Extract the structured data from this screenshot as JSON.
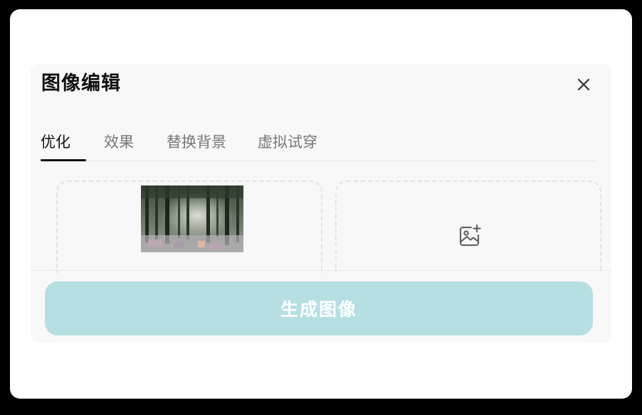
{
  "dialog": {
    "title": "图像编辑",
    "close_icon": "close-icon"
  },
  "tabs": [
    {
      "label": "优化",
      "active": true
    },
    {
      "label": "效果",
      "active": false
    },
    {
      "label": "替换背景",
      "active": false
    },
    {
      "label": "虚拟试穿",
      "active": false
    }
  ],
  "upload_slots": {
    "source": {
      "content": "forest-thumbnail-image"
    },
    "target": {
      "icon": "add-image-icon"
    }
  },
  "generate_button": {
    "label": "生成图像",
    "color": "#b5dfe3"
  },
  "colors": {
    "frame_bg": "#ffffff",
    "dialog_bg": "#f8f8f8",
    "active_tab": "#111111",
    "inactive_tab": "#777777"
  }
}
